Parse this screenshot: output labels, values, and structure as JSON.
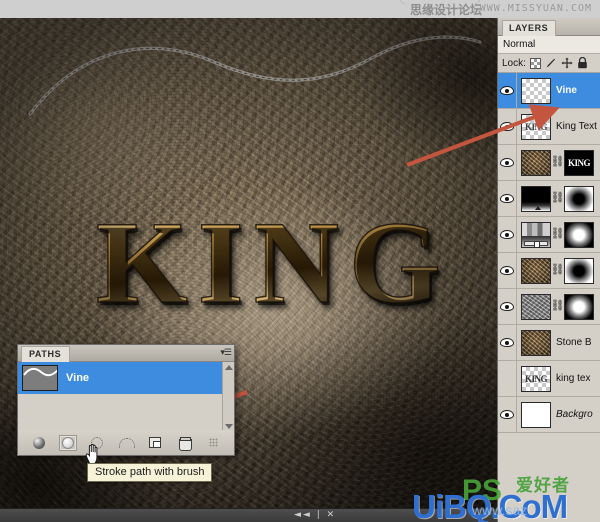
{
  "topbar": {
    "site_cn": "思缘设计论坛",
    "site_url": "WWW.MISSYUAN.COM"
  },
  "canvas": {
    "artwork_text": "KING",
    "bottom_nav": "◄◄ | ✕"
  },
  "layers_panel": {
    "tab_label": "LAYERS",
    "blend_mode": "Normal",
    "lock_label": "Lock:",
    "lock_icons": [
      "transparency-checker",
      "brush",
      "move",
      "lock"
    ],
    "rows": [
      {
        "name": "Vine",
        "visible": true,
        "selected": true,
        "thumb": "checker",
        "mask": null,
        "linked": false,
        "italic": false
      },
      {
        "name": "King Text",
        "visible": true,
        "selected": false,
        "thumb": "checker-king",
        "mask": null,
        "linked": false,
        "italic": false
      },
      {
        "name": "",
        "visible": true,
        "selected": false,
        "thumb": "stone",
        "mask": "king-text",
        "linked": true,
        "italic": false
      },
      {
        "name": "",
        "visible": true,
        "selected": false,
        "thumb": "black-grad",
        "mask": "dark-blob",
        "linked": true,
        "italic": false
      },
      {
        "name": "",
        "visible": true,
        "selected": false,
        "thumb": "grad-bars",
        "mask": "light-blob",
        "linked": true,
        "italic": false
      },
      {
        "name": "",
        "visible": true,
        "selected": false,
        "thumb": "stone",
        "mask": "dark-blob",
        "linked": true,
        "italic": false
      },
      {
        "name": "",
        "visible": true,
        "selected": false,
        "thumb": "grey-noise",
        "mask": "light-blob",
        "linked": true,
        "italic": false
      },
      {
        "name": "Stone B",
        "visible": true,
        "selected": false,
        "thumb": "stone",
        "mask": null,
        "linked": false,
        "italic": false
      },
      {
        "name": "king tex",
        "visible": false,
        "selected": false,
        "thumb": "checker-king",
        "mask": null,
        "linked": false,
        "italic": false
      },
      {
        "name": "Backgro",
        "visible": true,
        "selected": false,
        "thumb": "white",
        "mask": null,
        "linked": false,
        "italic": true
      }
    ]
  },
  "paths_panel": {
    "tab_label": "PATHS",
    "path_name": "Vine",
    "buttons": [
      {
        "name": "fill-path-with-foreground-color",
        "label": "Fill path with foreground color",
        "active": false
      },
      {
        "name": "stroke-path-with-brush",
        "label": "Stroke path with brush",
        "active": true
      },
      {
        "name": "load-path-as-selection",
        "label": "Load path as a selection",
        "active": false
      },
      {
        "name": "make-work-path-from-selection",
        "label": "Make work path from selection",
        "active": false
      },
      {
        "name": "create-new-path",
        "label": "Create new path",
        "active": false
      },
      {
        "name": "delete-current-path",
        "label": "Delete current path",
        "active": false
      }
    ],
    "tooltip": "Stroke path with brush"
  },
  "watermark": {
    "main": "UiBQ.CoM",
    "ps": "PS",
    "cn": "爱好者",
    "sub": "www.saz"
  },
  "colors": {
    "selection_blue": "#3d8ce0",
    "panel_grey": "#d4d0c8",
    "arrow_red": "#c4553f",
    "tooltip_bg": "#f6f2d8",
    "watermark_blue": "#2f6fd0",
    "watermark_green": "#4aa83a"
  }
}
